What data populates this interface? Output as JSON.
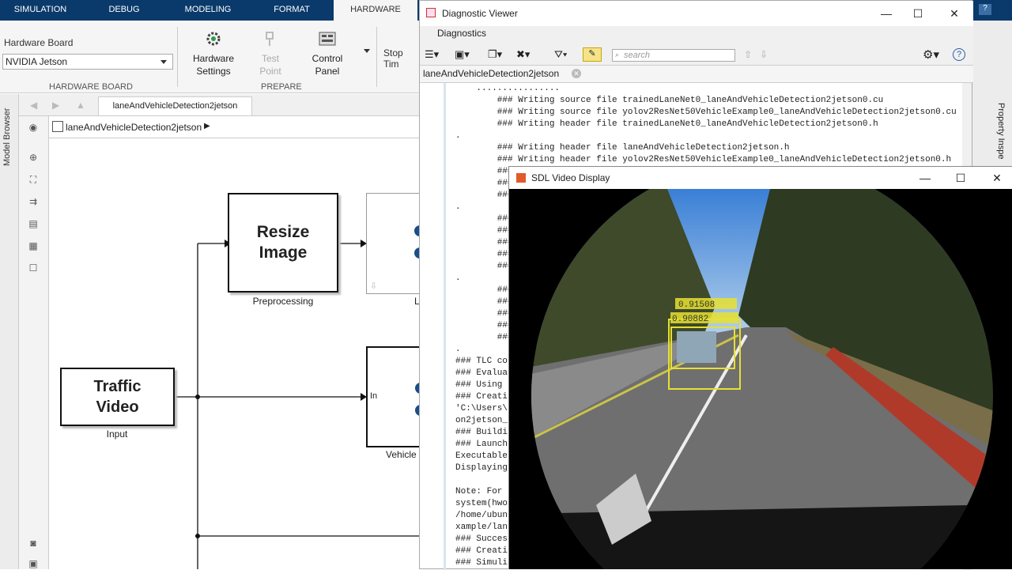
{
  "ribbon_tabs": [
    "SIMULATION",
    "DEBUG",
    "MODELING",
    "FORMAT",
    "HARDWARE"
  ],
  "ribbon": {
    "hw_board_label": "Hardware Board",
    "hw_board_value": "NVIDIA Jetson",
    "hw_group_label": "HARDWARE BOARD",
    "hw_settings_line1": "Hardware",
    "hw_settings_line2": "Settings",
    "test_point_line1": "Test",
    "test_point_line2": "Point",
    "control_panel_line1": "Control",
    "control_panel_line2": "Panel",
    "prepare_group_label": "PREPARE",
    "stop_time_label": "Stop Tim"
  },
  "model_browser_label": "Model Browser",
  "model_tab": "laneAndVehicleDetection2jetson",
  "breadcrumb": "laneAndVehicleDetection2jetson",
  "blocks": {
    "resize_line1": "Resize",
    "resize_line2": "Image",
    "resize_caption": "Preprocessing",
    "traffic_line1": "Traffic",
    "traffic_line2": "Video",
    "traffic_caption": "Input",
    "lane_caption": "L",
    "vehicle_caption": "Vehicle",
    "vehicle_port": "In"
  },
  "diagnostic": {
    "title": "Diagnostic Viewer",
    "tab": "Diagnostics",
    "search_placeholder": "search",
    "doc_tab": "laneAndVehicleDetection2jetson",
    "log": "    ................\n        ### Writing source file trainedLaneNet0_laneAndVehicleDetection2jetson0.cu\n        ### Writing source file yolov2ResNet50VehicleExample0_laneAndVehicleDetection2jetson0.cu\n        ### Writing header file trainedLaneNet0_laneAndVehicleDetection2jetson0.h\n.\n        ### Writing header file laneAndVehicleDetection2jetson.h\n        ### Writing header file yolov2ResNet50VehicleExample0_laneAndVehicleDetection2jetson0.h\n        ### Wr\n        ### Wr\n        ### Wr\n.\n        ### Wr\n        ### Wr\n        ### Wr\n        ### Wr\n        ### Wr\n.\n        ### Wr\n        ### Wr\n        ### Wr\n        ### Wr\n        ### Wr\n.\n### TLC co\n### Evalua\n### Using \n### Creati\n'C:\\Users\\\non2jetson_\n### Buildi\n### Launch\nExecutable\nDisplaying\n\nNote: For\nsystem(hwo\n/home/ubun\nxample/lan\n### Succes\n### Creati\n### Simuli"
  },
  "sdl": {
    "title": "SDL Video Display",
    "det1": "0.91508",
    "det2": "0.90882"
  },
  "right_panel_label": "Property Inspe",
  "colors": {
    "ribbon_bg": "#0a3a6b",
    "detect_yellow": "#e8e030"
  }
}
